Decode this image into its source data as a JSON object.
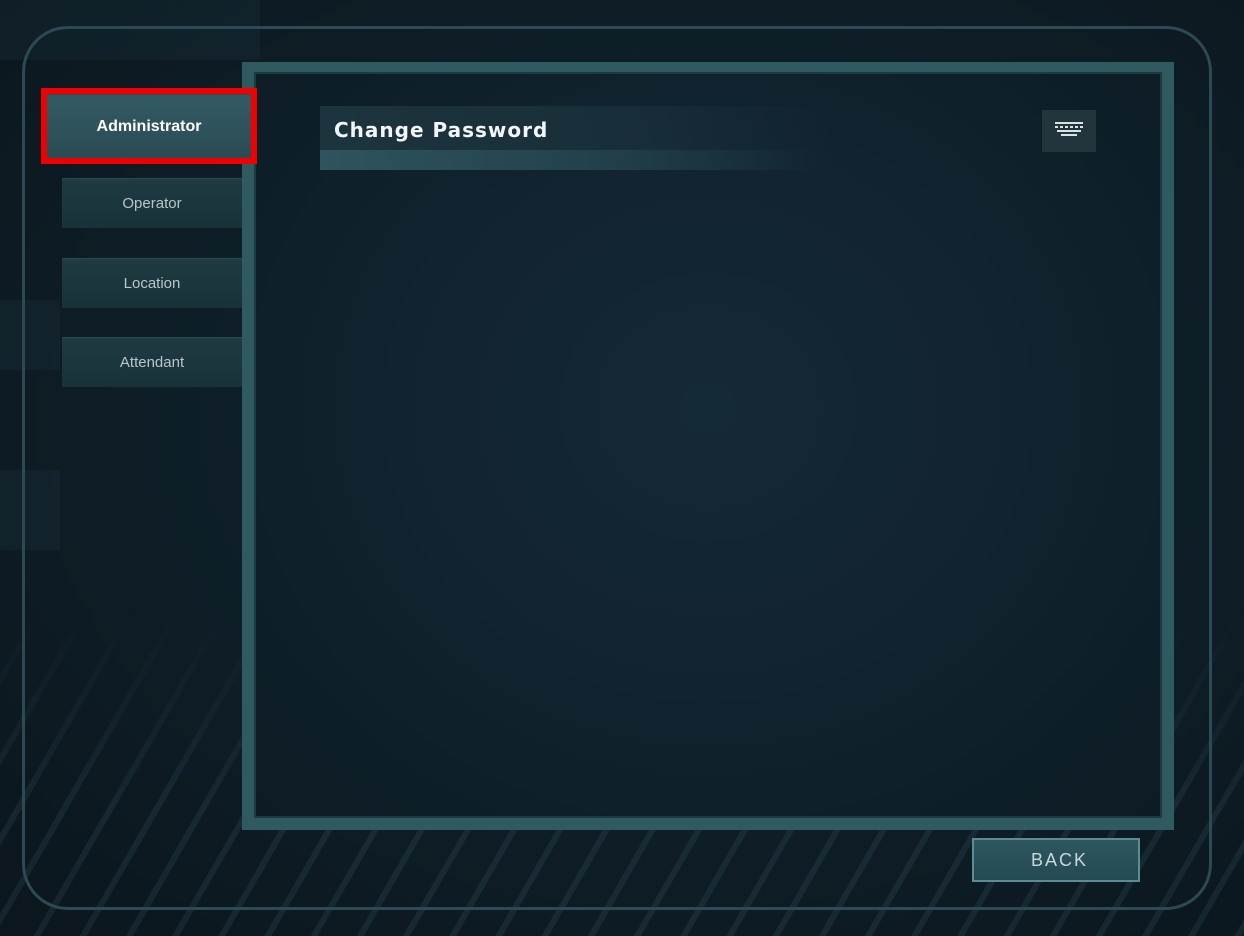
{
  "sidebar": {
    "items": [
      {
        "label": "Administrator",
        "active": true
      },
      {
        "label": "Operator",
        "active": false
      },
      {
        "label": "Location",
        "active": false
      },
      {
        "label": "Attendant",
        "active": false
      }
    ]
  },
  "main": {
    "title": "Change Password",
    "keyboard_icon": "keyboard-icon"
  },
  "footer": {
    "back_label": "BACK"
  },
  "colors": {
    "highlight": "#f00000",
    "panel_border": "#2e5a60",
    "background": "#0f1c24"
  }
}
